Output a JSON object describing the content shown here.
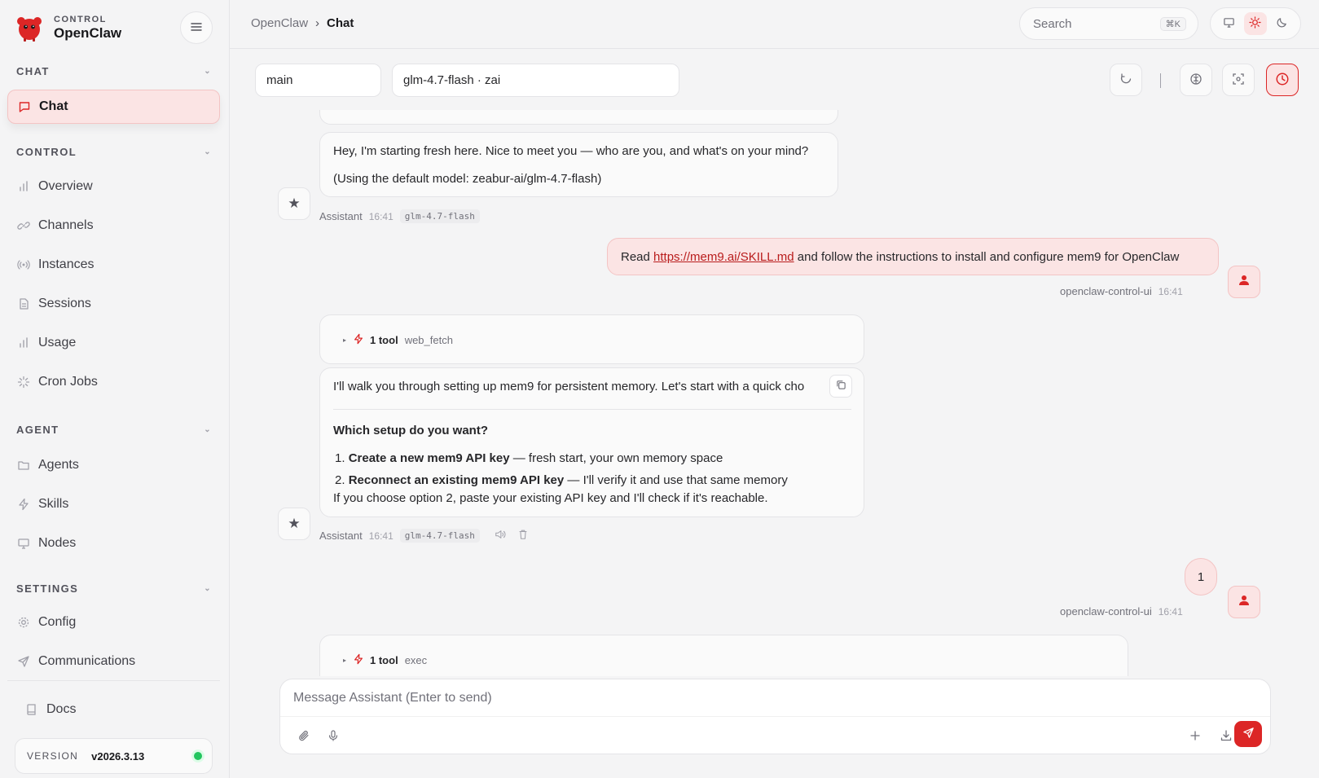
{
  "brand": {
    "sub": "CONTROL",
    "name": "OpenClaw"
  },
  "sidebar": {
    "sections": [
      {
        "label": "CHAT"
      },
      {
        "label": "CONTROL"
      },
      {
        "label": "AGENT"
      },
      {
        "label": "SETTINGS"
      }
    ],
    "items": [
      {
        "label": "Chat"
      },
      {
        "label": "Overview"
      },
      {
        "label": "Channels"
      },
      {
        "label": "Instances"
      },
      {
        "label": "Sessions"
      },
      {
        "label": "Usage"
      },
      {
        "label": "Cron Jobs"
      },
      {
        "label": "Agents"
      },
      {
        "label": "Skills"
      },
      {
        "label": "Nodes"
      },
      {
        "label": "Config"
      },
      {
        "label": "Communications"
      }
    ],
    "docs": "Docs",
    "version_label": "VERSION",
    "version_value": "v2026.3.13"
  },
  "topbar": {
    "crumb_root": "OpenClaw",
    "crumb_sep": "›",
    "crumb_current": "Chat",
    "search_placeholder": "Search",
    "search_kbd": "⌘K"
  },
  "controls": {
    "agent": "main",
    "model": "glm-4.7-flash · zai"
  },
  "messages": {
    "m1": {
      "line1": "Hey, I'm starting fresh here. Nice to meet you — who are you, and what's on your mind?",
      "line2": "(Using the default model: zeabur-ai/glm-4.7-flash)",
      "sender": "Assistant",
      "time": "16:41",
      "model": "glm-4.7-flash"
    },
    "m2": {
      "prefix": "Read ",
      "link": "https://mem9.ai/SKILL.md",
      "suffix": " and follow the instructions to install and configure mem9 for OpenClaw",
      "sender": "openclaw-control-ui",
      "time": "16:41"
    },
    "m3": {
      "tool_count": "1 tool",
      "tool_name": "web_fetch",
      "intro": "I'll walk you through setting up mem9 for persistent memory. Let's start with a quick cho",
      "heading": "Which setup do you want?",
      "opt1_num": "1.",
      "opt1_bold": "Create a new mem9 API key",
      "opt1_rest": " — fresh start, your own memory space",
      "opt2_num": "2.",
      "opt2_bold": "Reconnect an existing mem9 API key",
      "opt2_rest": " — I'll verify it and use that same memory",
      "footer": "If you choose option 2, paste your existing API key and I'll check if it's reachable.",
      "sender": "Assistant",
      "time": "16:41",
      "model": "glm-4.7-flash"
    },
    "m4": {
      "text": "1",
      "sender": "openclaw-control-ui",
      "time": "16:41"
    },
    "m5": {
      "tool_count": "1 tool",
      "tool_name": "exec"
    }
  },
  "composer": {
    "placeholder": "Message Assistant (Enter to send)"
  }
}
